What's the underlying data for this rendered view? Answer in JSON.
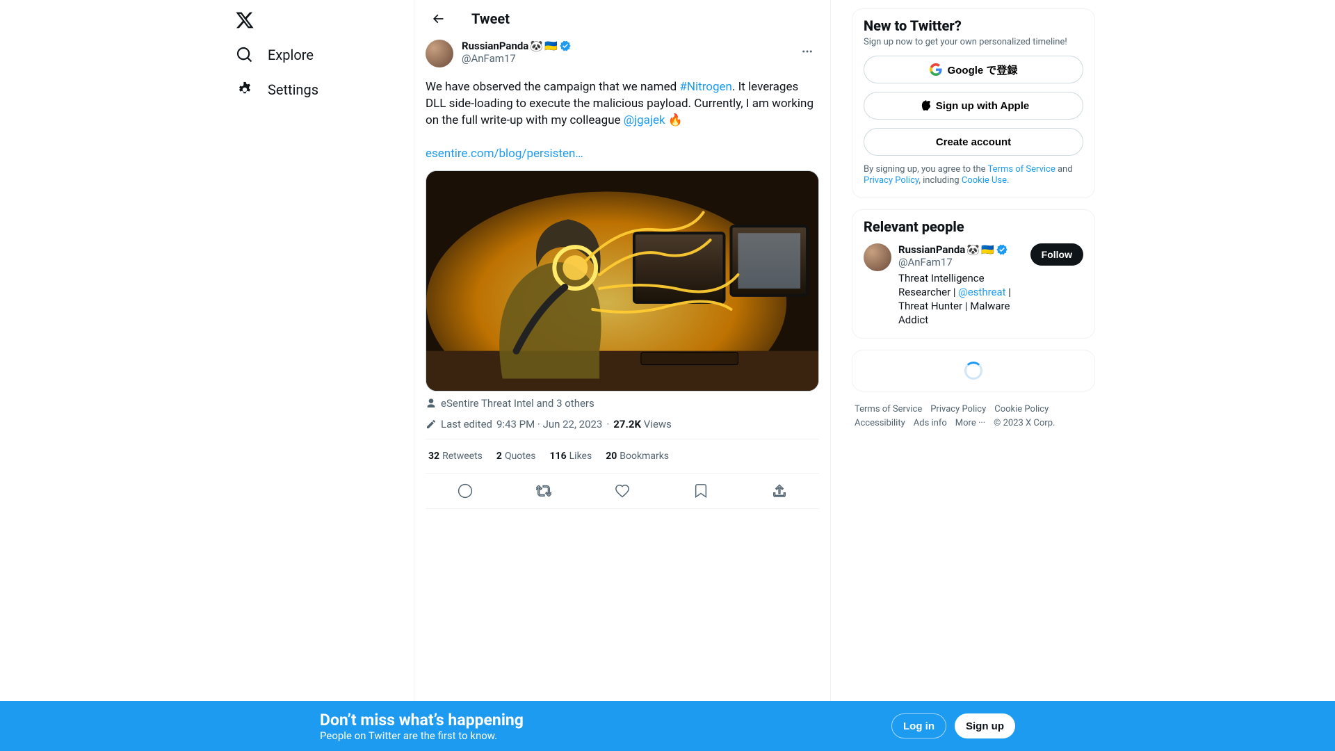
{
  "nav": {
    "explore": "Explore",
    "settings": "Settings"
  },
  "header": {
    "title": "Tweet"
  },
  "tweet": {
    "author": {
      "name": "RussianPanda",
      "emoji1": "🐼",
      "flag": "🇺🇦",
      "handle": "@AnFam17"
    },
    "body_1": "We have observed the campaign that we named ",
    "hashtag": "#Nitrogen",
    "body_2": ". It leverages DLL side-loading to execute the malicious payload. Currently, I am working on the full write-up with my colleague ",
    "mention": "@jgajek",
    "fire": "🔥",
    "link": "esentire.com/blog/persisten…",
    "tagged": "eSentire Threat Intel and 3 others",
    "meta_prefix": "Last edited",
    "meta_time": "9:43 PM · Jun 22, 2023",
    "views_count": "27.2K",
    "views_label": "Views",
    "stats": {
      "retweets_n": "32",
      "retweets_l": "Retweets",
      "quotes_n": "2",
      "quotes_l": "Quotes",
      "likes_n": "116",
      "likes_l": "Likes",
      "bookmarks_n": "20",
      "bookmarks_l": "Bookmarks"
    }
  },
  "signup": {
    "title": "New to Twitter?",
    "sub": "Sign up now to get your own personalized timeline!",
    "google": "Google で登録",
    "apple": "Sign up with Apple",
    "create": "Create account",
    "tos_1": "By signing up, you agree to the ",
    "tos_link1": "Terms of Service",
    "tos_2": " and ",
    "tos_link2": "Privacy Policy",
    "tos_3": ", including ",
    "tos_link3": "Cookie Use."
  },
  "relevant": {
    "title": "Relevant people",
    "name": "RussianPanda",
    "emoji1": "🐼",
    "flag": "🇺🇦",
    "handle": "@AnFam17",
    "bio_1": "Threat Intelligence Researcher | ",
    "bio_link": "@esthreat",
    "bio_2": " | Threat Hunter | Malware Addict",
    "follow": "Follow"
  },
  "footer": {
    "tos": "Terms of Service",
    "pp": "Privacy Policy",
    "cp": "Cookie Policy",
    "acc": "Accessibility",
    "ads": "Ads info",
    "more": "More ···",
    "copy": "© 2023 X Corp."
  },
  "banner": {
    "title": "Don’t miss what’s happening",
    "sub": "People on Twitter are the first to know.",
    "login": "Log in",
    "signup": "Sign up"
  }
}
